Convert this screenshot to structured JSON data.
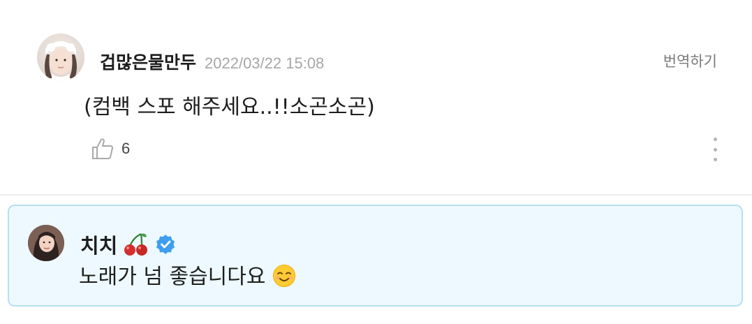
{
  "comment": {
    "author": "겁많은물만두",
    "timestamp": "2022/03/22 15:08",
    "translate_label": "번역하기",
    "text": "(컴백 스포 해주세요..!!소곤소곤)",
    "like_count": "6"
  },
  "reply": {
    "author": "치치",
    "text": "노래가 넘 좋습니다요",
    "name_emoji": "cherries-icon",
    "text_emoji": "smiling-face-icon"
  },
  "colors": {
    "reply_background": "#edf9fe",
    "reply_border": "#b7e0ef",
    "verified_badge": "#3d9ef0",
    "timestamp": "#a6a6a6"
  }
}
